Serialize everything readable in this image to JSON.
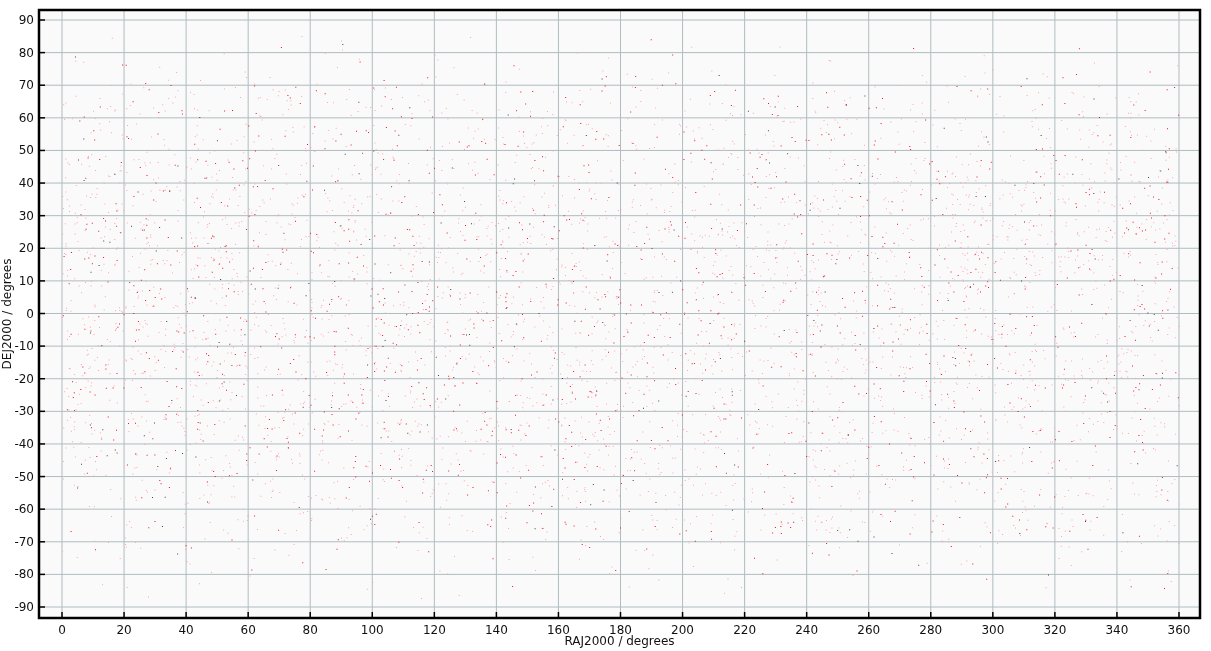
{
  "plot": {
    "x_axis": {
      "title": "RAJ2000 / degrees",
      "ticks": [
        "0",
        "20",
        "40",
        "60",
        "80",
        "100",
        "120",
        "140",
        "160",
        "180",
        "200",
        "220",
        "240",
        "260",
        "280",
        "300",
        "320",
        "340",
        "360"
      ]
    },
    "y_axis": {
      "title": "DEJ2000 / degrees",
      "ticks": [
        "90",
        "80",
        "70",
        "60",
        "50",
        "40",
        "30",
        "20",
        "10",
        "0",
        "-10",
        "-20",
        "-30",
        "-40",
        "-50",
        "-60",
        "-70",
        "-80",
        "-90"
      ]
    }
  }
}
